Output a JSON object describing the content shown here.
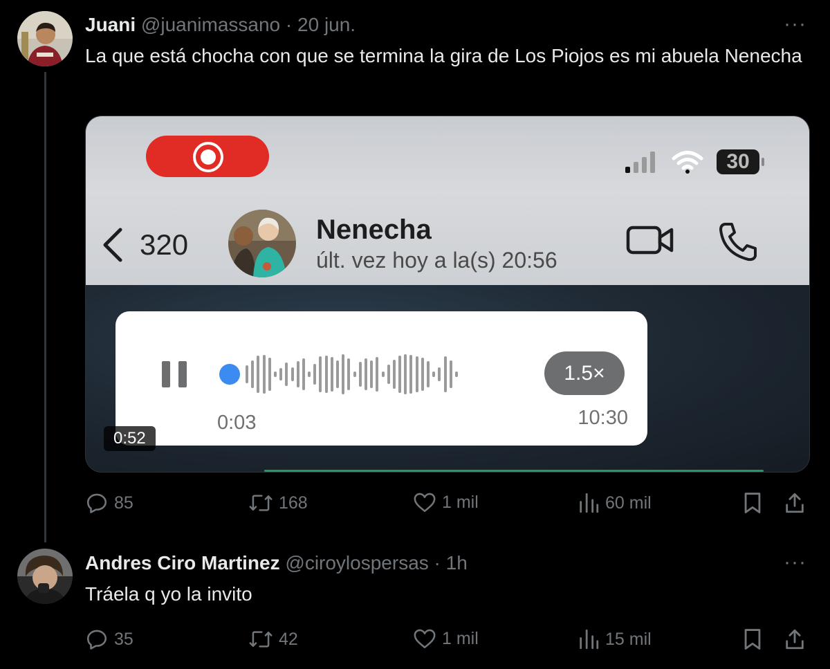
{
  "tweets": [
    {
      "author_name": "Juani",
      "handle": "@juanimassano",
      "separator": "·",
      "time": "20 jun.",
      "more_label": "···",
      "text": "La que está chocha con que se termina la gira de Los Piojos es mi abuela Nenecha",
      "stats": {
        "replies": "85",
        "reposts": "168",
        "likes": "1 mil",
        "views": "60 mil"
      },
      "media": {
        "duration": "0:52",
        "battery": "30",
        "back_count": "320",
        "contact_name": "Nenecha",
        "contact_status": "últ. vez hoy a la(s) 20:56",
        "voice_note": {
          "current_time": "0:03",
          "sent_time": "10:30",
          "speed": "1.5×"
        }
      }
    },
    {
      "author_name": "Andres Ciro Martinez",
      "handle": "@ciroylospersas",
      "separator": "·",
      "time": "1h",
      "more_label": "···",
      "text": "Tráela q yo la invito",
      "stats": {
        "replies": "35",
        "reposts": "42",
        "likes": "1 mil",
        "views": "15 mil"
      }
    }
  ],
  "colors": {
    "background": "#000000",
    "text": "#e7e9ea",
    "muted": "#71767b",
    "rec_red": "#e12b25",
    "voice_blue": "#3b8bf0"
  },
  "icons": [
    "reply-icon",
    "repost-icon",
    "like-icon",
    "views-icon",
    "bookmark-icon",
    "share-icon"
  ]
}
